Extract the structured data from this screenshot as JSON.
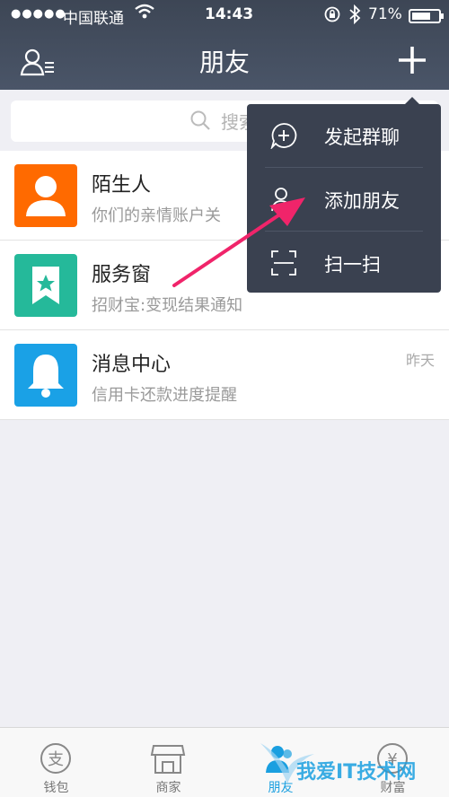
{
  "status_bar": {
    "signal": "●●●●●",
    "carrier": "中国联通",
    "time": "14:43",
    "battery": "71%",
    "battery_level": 0.71
  },
  "nav": {
    "title": "朋友"
  },
  "search": {
    "placeholder": "搜索"
  },
  "list": [
    {
      "title": "陌生人",
      "subtitle": "你们的亲情账户关",
      "time": "",
      "icon": "person-icon",
      "color": "#ff6a00"
    },
    {
      "title": "服务窗",
      "subtitle": "招财宝:变现结果通知",
      "time": "",
      "icon": "bookmark-star-icon",
      "color": "#25b99a"
    },
    {
      "title": "消息中心",
      "subtitle": "信用卡还款进度提醒",
      "time": "昨天",
      "icon": "bell-icon",
      "color": "#1aa1e6"
    }
  ],
  "menu": {
    "items": [
      {
        "label": "发起群聊",
        "icon": "chat-plus-icon"
      },
      {
        "label": "添加朋友",
        "icon": "add-friend-icon"
      },
      {
        "label": "扫一扫",
        "icon": "scan-icon"
      }
    ]
  },
  "tabbar": {
    "tabs": [
      {
        "label": "钱包",
        "icon": "wallet-icon"
      },
      {
        "label": "商家",
        "icon": "store-icon"
      },
      {
        "label": "朋友",
        "icon": "friends-icon",
        "active": true
      },
      {
        "label": "财富",
        "icon": "wealth-icon"
      }
    ]
  },
  "watermark": {
    "text": "我爱IT技术网"
  },
  "colors": {
    "header": "#3d4655",
    "accent": "#1a9fe0",
    "arrow": "#f0246a"
  }
}
